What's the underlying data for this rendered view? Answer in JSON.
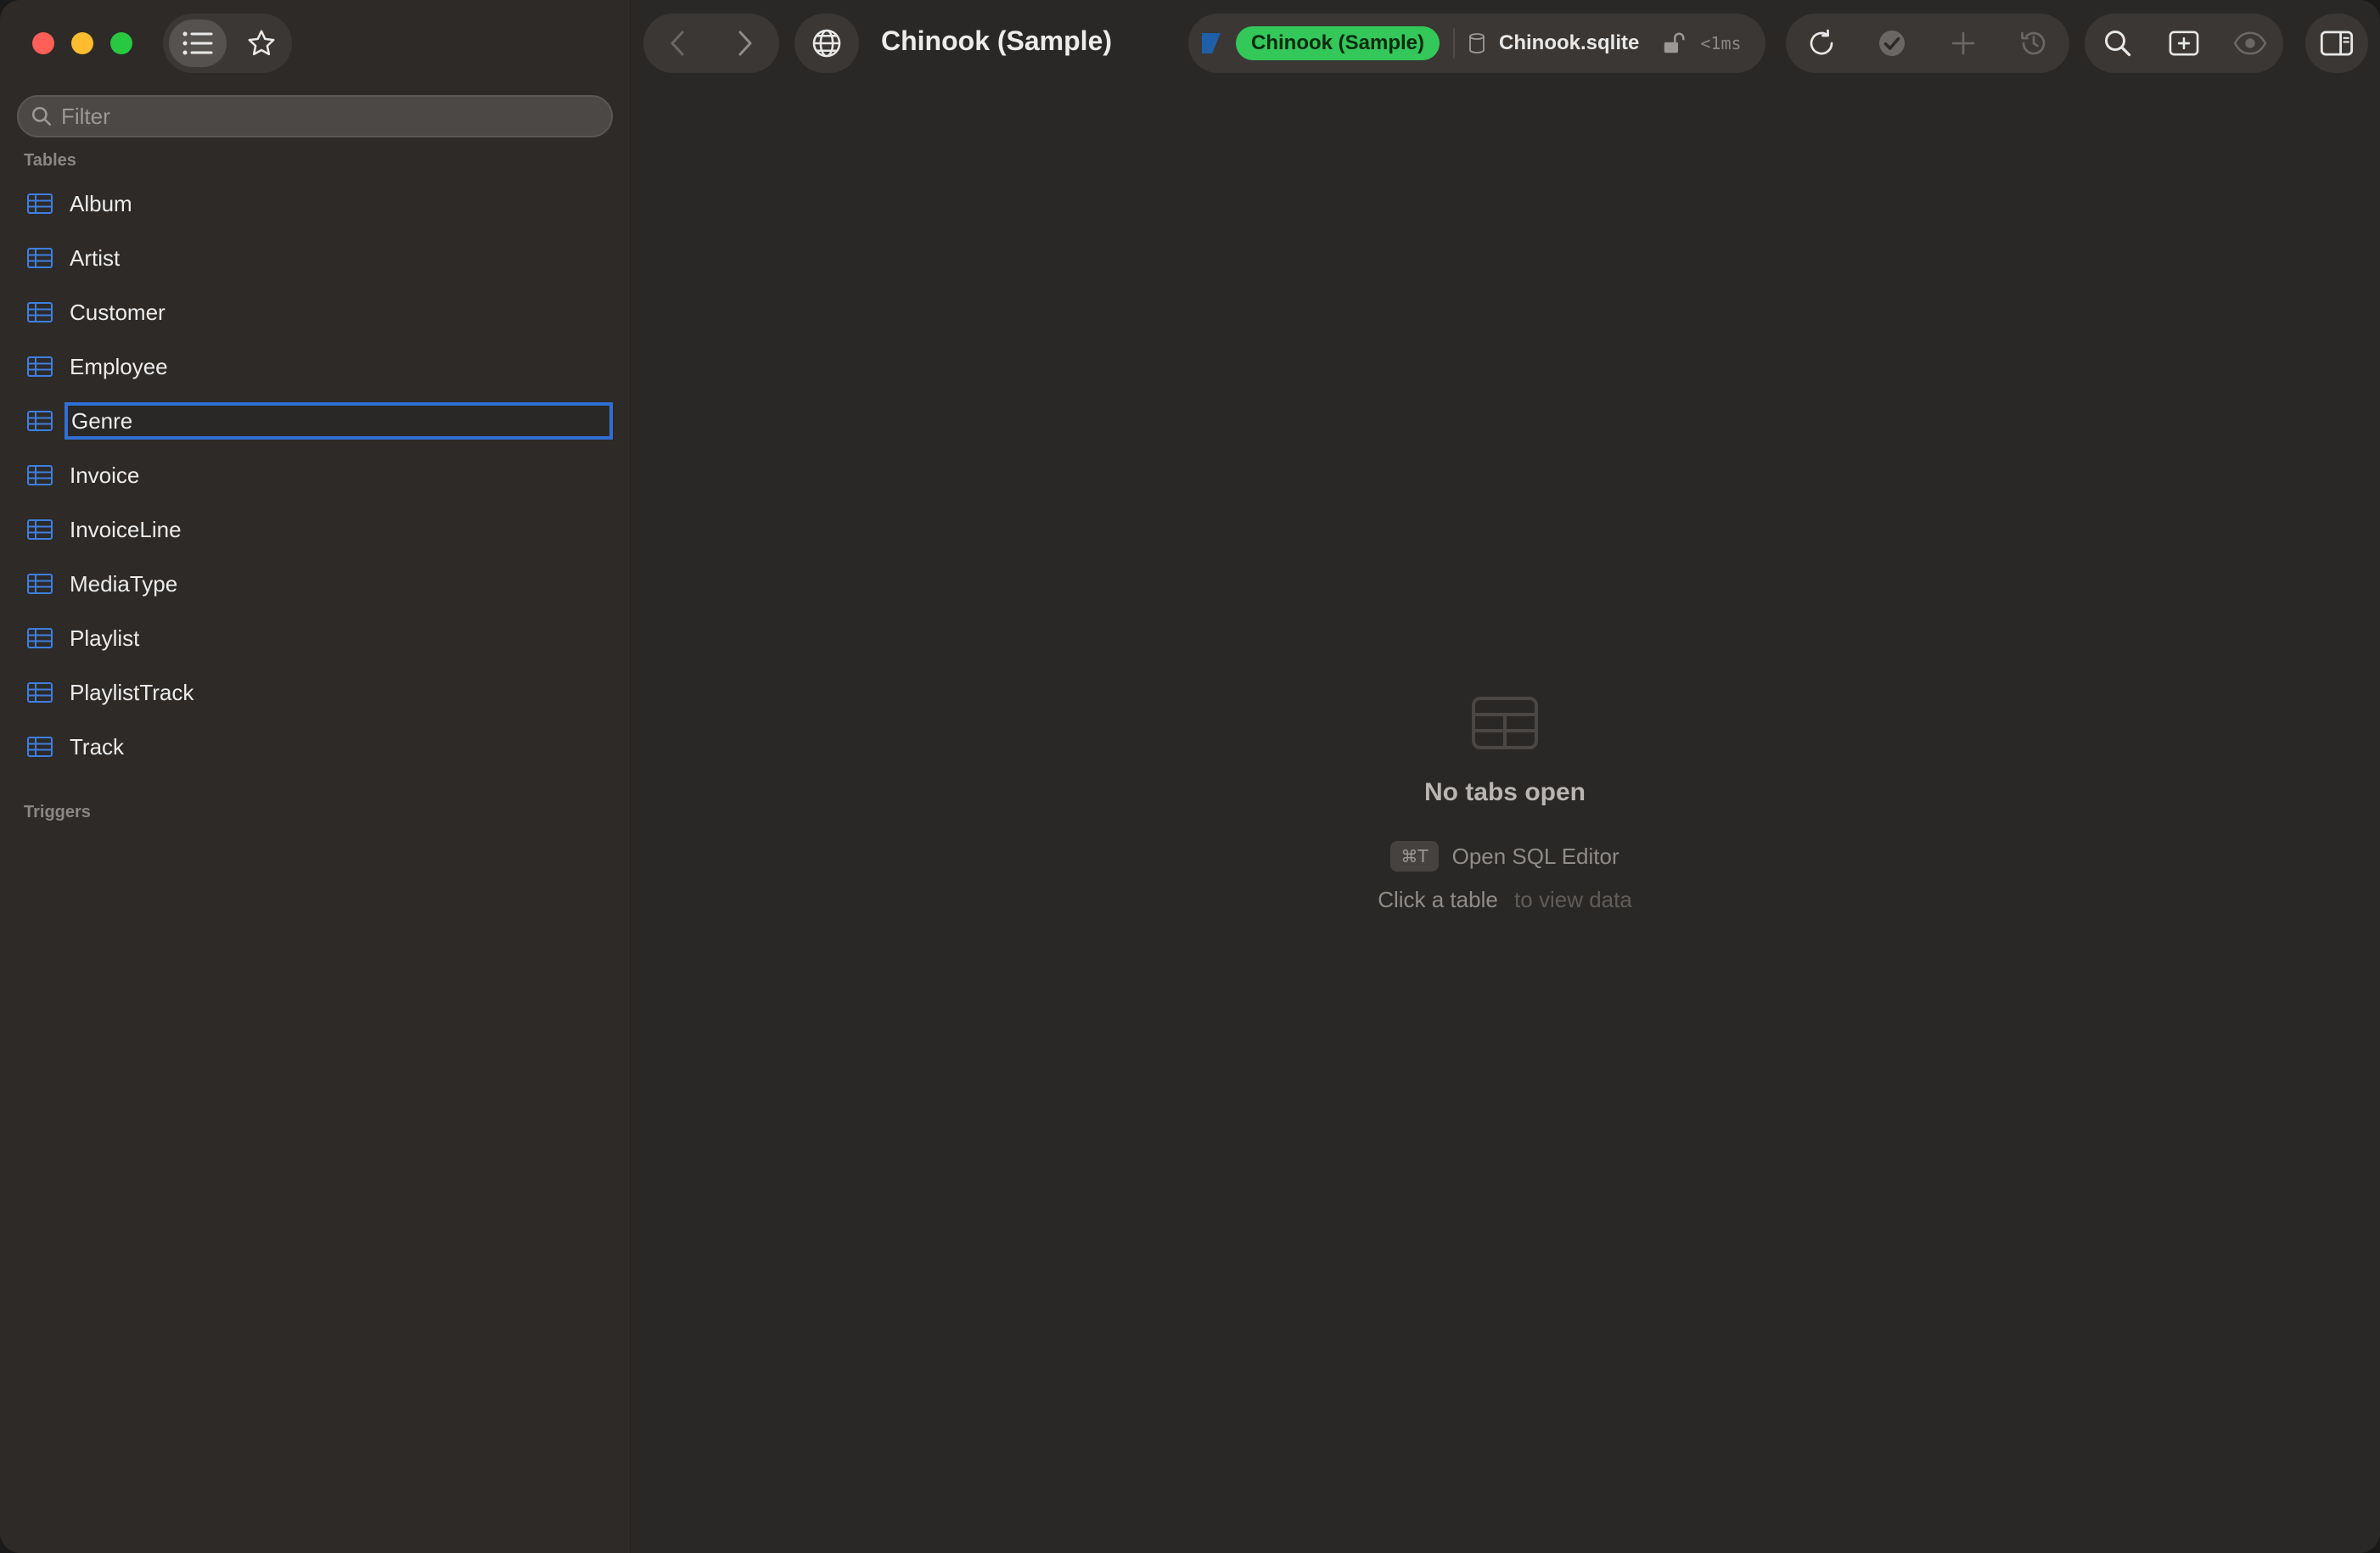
{
  "window": {
    "title": "Chinook (Sample)"
  },
  "sidebar": {
    "filter_placeholder": "Filter",
    "tables_heading": "Tables",
    "tables": [
      {
        "label": "Album"
      },
      {
        "label": "Artist"
      },
      {
        "label": "Customer"
      },
      {
        "label": "Employee"
      },
      {
        "label": "Genre"
      },
      {
        "label": "Invoice"
      },
      {
        "label": "InvoiceLine"
      },
      {
        "label": "MediaType"
      },
      {
        "label": "Playlist"
      },
      {
        "label": "PlaylistTrack"
      },
      {
        "label": "Track"
      }
    ],
    "editing_table": "Genre",
    "triggers_heading": "Triggers"
  },
  "toolbar": {
    "connection_name": "Chinook (Sample)",
    "database_file": "Chinook.sqlite",
    "latency": "<1ms"
  },
  "empty_state": {
    "title": "No tabs open",
    "shortcut_key": "⌘T",
    "shortcut_label": "Open SQL Editor",
    "hint_primary": "Click a table",
    "hint_secondary": "to view data"
  },
  "colors": {
    "accent": "#2f6fd6",
    "connection_badge": "#34c759",
    "window_bg": "#2a2826",
    "sidebar_bg": "#2d2a28"
  }
}
